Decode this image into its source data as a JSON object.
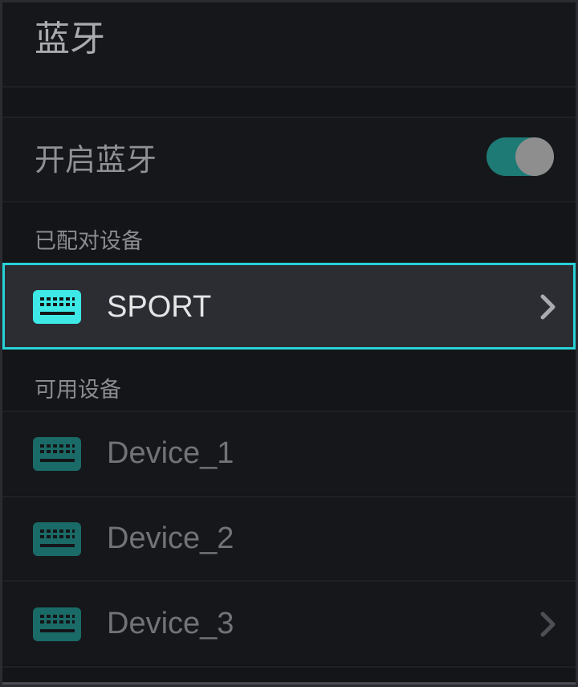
{
  "header": {
    "title": "蓝牙"
  },
  "bluetooth": {
    "label": "开启蓝牙",
    "enabled": true
  },
  "paired": {
    "section_label": "已配对设备",
    "devices": [
      {
        "name": "SPORT",
        "icon": "keyboard-icon",
        "selected": true
      }
    ]
  },
  "available": {
    "section_label": "可用设备",
    "devices": [
      {
        "name": "Device_1",
        "icon": "keyboard-icon"
      },
      {
        "name": "Device_2",
        "icon": "keyboard-icon"
      },
      {
        "name": "Device_3",
        "icon": "keyboard-icon"
      }
    ]
  },
  "colors": {
    "accent": "#27d2d6",
    "toggle_on": "#1d7a74",
    "icon_active": "#3de8e6",
    "icon_inactive": "#1a6b67"
  }
}
